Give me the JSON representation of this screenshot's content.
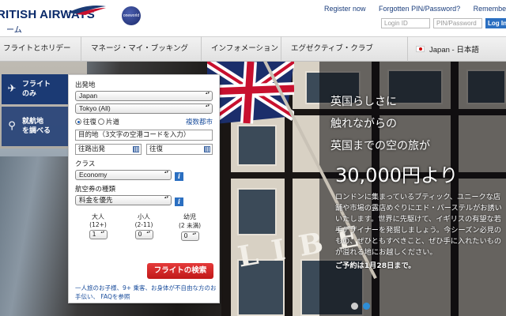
{
  "header": {
    "brand": "RITISH AIRWAYS",
    "brand_sub": "ーム",
    "oneworld": "oneworld",
    "links": {
      "register": "Register now",
      "forgotten": "Forgotten PIN/Password?",
      "remember": "Remember m"
    },
    "login": {
      "id_placeholder": "Login ID",
      "pin_placeholder": "PIN/Password",
      "button": "Log In"
    }
  },
  "nav": {
    "items": [
      {
        "label": "フライトとホリデー"
      },
      {
        "label": "マネージ・マイ・ブッキング"
      },
      {
        "label": "インフォメーション"
      },
      {
        "label": "エグゼクティブ・クラブ"
      }
    ],
    "language": "Japan - 日本語"
  },
  "tabs": {
    "flight": "フライト\nのみ",
    "flight_line1": "フライト",
    "flight_line2": "のみ",
    "dest_line1": "就航地",
    "dest_line2": "を調べる"
  },
  "form": {
    "origin_label": "出発地",
    "origin_country": "Japan",
    "origin_city": "Tokyo (All)",
    "trip_return": "往復",
    "trip_oneway": "片道",
    "multi_city": "複数都市",
    "destination_placeholder": "目的地（3文字の空港コードを入力）",
    "depart_placeholder": "往路出発",
    "return_placeholder": "往復",
    "class_label": "クラス",
    "class_value": "Economy",
    "fare_label": "航空券の種類",
    "fare_value": "料金を優先",
    "adult_label": "大人",
    "adult_range": "(12+)",
    "adult_value": "1",
    "child_label": "小人",
    "child_range": "(2-11)",
    "child_value": "0",
    "infant_label": "幼児",
    "infant_range": "(2 未満)",
    "infant_value": "0",
    "search_button": "フライトの検索",
    "help_text": "一人旅のお子様、9+ 乗客、お身体が不自由な方のお手伝い、 FAQを参照"
  },
  "promo": {
    "line1": "英国らしさに",
    "line2": "触れながらの",
    "line3": "英国までの空の旅が",
    "price": "30,000円より",
    "body": "ロンドンに集まっているブティック、ユニークな店舗や市場の露店めぐりにエド・パーステルがお誘いいたします。世界に先駆けて、イギリスの有望な若手デザイナーを発掘しましょう。今シーズン必見のもの、ぜひともすべきこと、ぜひ手に入れたいものが溢れる地にお越しください。",
    "note": "ご予約は1月28日まで。"
  },
  "hero": {
    "sign": "LIBE"
  },
  "pager": {
    "count": 2,
    "active_index": 1
  },
  "colors": {
    "brand_navy": "#0a2a6a",
    "tab_blue": "#1b3a74",
    "search_red": "#d42424",
    "link_blue": "#1a4d9c"
  }
}
